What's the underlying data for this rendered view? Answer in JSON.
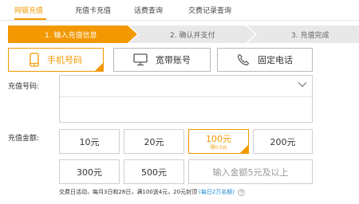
{
  "tabs": [
    {
      "label": "网银充值",
      "active": true
    },
    {
      "label": "充值卡充值",
      "active": false
    },
    {
      "label": "话费查询",
      "active": false
    },
    {
      "label": "交费记录查询",
      "active": false
    }
  ],
  "steps": [
    {
      "label": "1. 输入充值信息",
      "active": true
    },
    {
      "label": "2. 确认并支付",
      "active": false
    },
    {
      "label": "3. 充值完成",
      "active": false
    }
  ],
  "types": [
    {
      "label": "手机号码",
      "icon": "mobile-phone-icon",
      "selected": true
    },
    {
      "label": "宽带账号",
      "icon": "monitor-icon",
      "selected": false
    },
    {
      "label": "固定电话",
      "icon": "telephone-icon",
      "selected": false
    }
  ],
  "number": {
    "label": "充值号码:",
    "value": ""
  },
  "amount": {
    "label": "充值金额:",
    "options": [
      {
        "label": "10元"
      },
      {
        "label": "20元"
      },
      {
        "label": "100元",
        "sub": "得0.5元",
        "selected": true
      },
      {
        "label": "200元"
      },
      {
        "label": "300元"
      },
      {
        "label": "500元"
      }
    ],
    "custom_placeholder": "输入金额5元及以上"
  },
  "promo": {
    "text": "交费日活动，每月3日和28日，满100送4元，20元封顶",
    "link": "(每日2万名额)"
  },
  "colors": {
    "accent": "#f39800",
    "link": "#1a8ad4"
  }
}
